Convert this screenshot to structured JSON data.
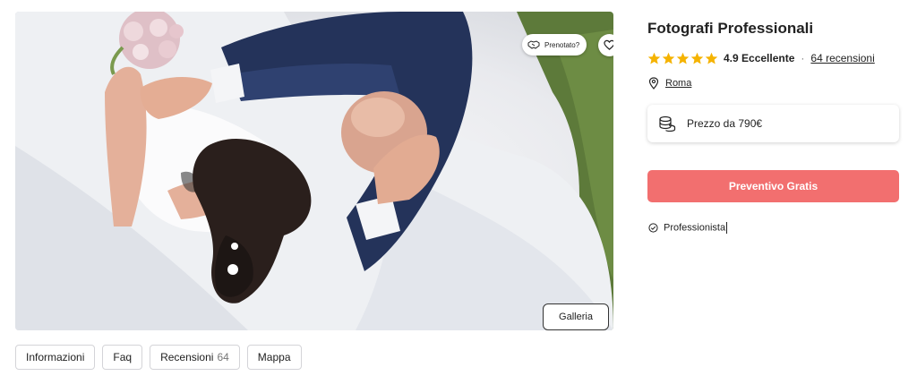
{
  "photo": {
    "booked_badge": "Prenotato?",
    "gallery_button": "Galleria"
  },
  "tabs": [
    {
      "label": "Informazioni"
    },
    {
      "label": "Faq"
    },
    {
      "label": "Recensioni",
      "count": "64"
    },
    {
      "label": "Mappa"
    }
  ],
  "vendor": {
    "name": "Fotografi Professionali",
    "rating": "4.9 Eccellente",
    "stars": 5,
    "separator": "·",
    "reviews_link": "64 recensioni",
    "location": "Roma",
    "price": "Prezzo da 790€",
    "quote_button": "Preventivo Gratis",
    "badge": "Professionista"
  },
  "colors": {
    "accent": "#f26f6f",
    "star": "#f5b301"
  },
  "icons": {
    "booked": "handshake-icon",
    "favorite": "heart-icon",
    "location": "location-pin-icon",
    "price": "coins-icon",
    "pro": "check-circle-icon",
    "star": "star-icon"
  }
}
